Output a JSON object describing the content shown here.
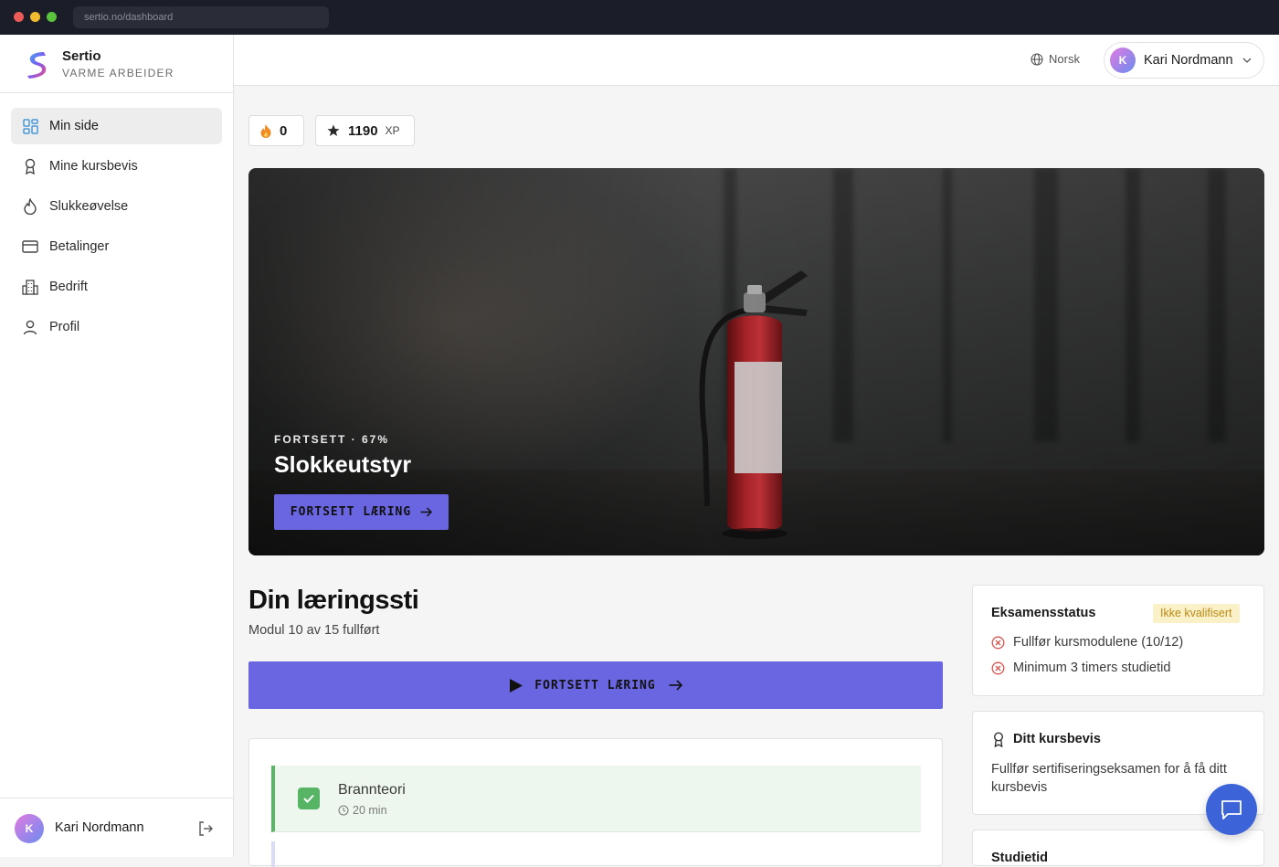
{
  "browser": {
    "url": "sertio.no/dashboard"
  },
  "brand": {
    "name": "Sertio",
    "subtitle": "VARME ARBEIDER"
  },
  "sidebar": {
    "items": [
      {
        "label": "Min side",
        "icon": "grid-icon",
        "active": true
      },
      {
        "label": "Mine kursbevis",
        "icon": "award-icon",
        "active": false
      },
      {
        "label": "Slukkeøvelse",
        "icon": "flame-icon",
        "active": false
      },
      {
        "label": "Betalinger",
        "icon": "credit-card-icon",
        "active": false
      },
      {
        "label": "Bedrift",
        "icon": "building-icon",
        "active": false
      },
      {
        "label": "Profil",
        "icon": "user-icon",
        "active": false
      }
    ],
    "footer": {
      "avatar_initial": "K",
      "user_name": "Kari Nordmann"
    }
  },
  "header": {
    "language": "Norsk",
    "user": {
      "avatar_initial": "K",
      "name": "Kari Nordmann"
    }
  },
  "stats": {
    "streak": {
      "value": "0"
    },
    "xp": {
      "value": "1190",
      "unit": "XP"
    }
  },
  "hero": {
    "eyebrow": "FORTSETT · 67%",
    "title": "Slokkeutstyr",
    "button_label": "FORTSETT LÆRING"
  },
  "learning_path": {
    "title": "Din læringssti",
    "subtitle": "Modul 10 av 15 fullført",
    "button_label": "FORTSETT LÆRING",
    "modules": [
      {
        "title": "Brannteori",
        "duration": "20 min",
        "completed": true
      }
    ]
  },
  "exam_status": {
    "title": "Eksamensstatus",
    "badge": "Ikke kvalifisert",
    "requirements": [
      {
        "label": "Fullfør kursmodulene (10/12)",
        "met": false
      },
      {
        "label": "Minimum 3 timers studietid",
        "met": false
      }
    ]
  },
  "certificate": {
    "title": "Ditt kursbevis",
    "description": "Fullfør sertifiseringseksamen for å få ditt kursbevis"
  },
  "study_time": {
    "title": "Studietid"
  },
  "colors": {
    "accent": "#6a66e2",
    "success": "#57b465",
    "error": "#d9534f",
    "warning_bg": "#fbf1c9",
    "warning_text": "#b98a16",
    "chat": "#3d63d8"
  }
}
